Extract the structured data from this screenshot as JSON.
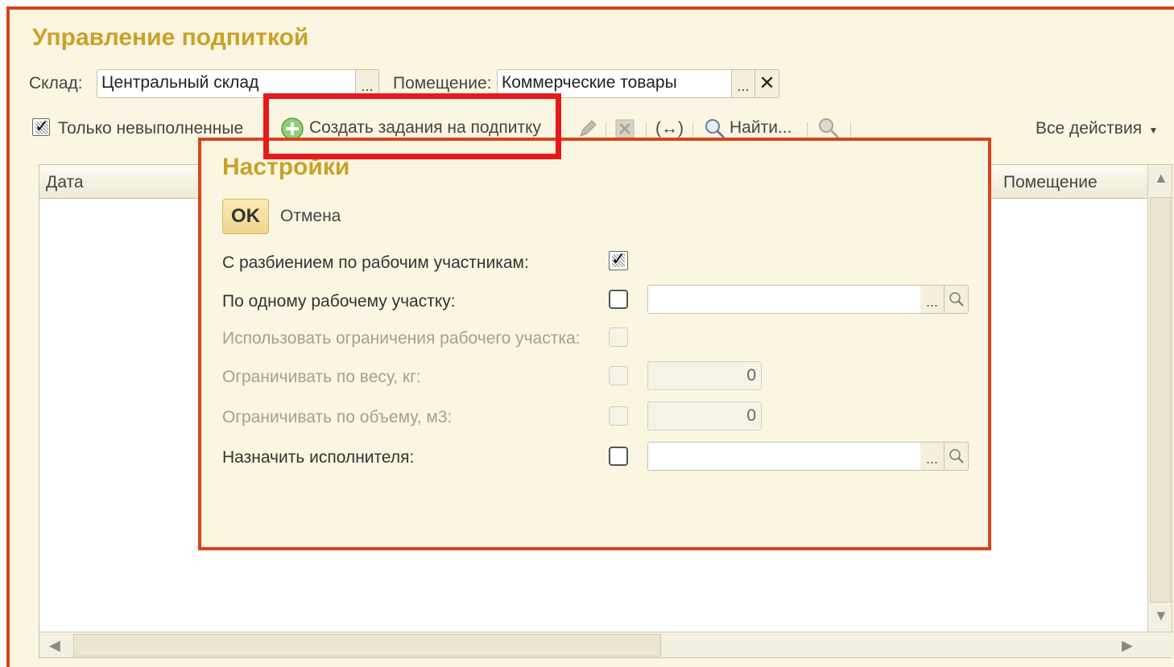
{
  "window": {
    "title": "Управление подпиткой"
  },
  "filters": {
    "warehouse_label": "Склад:",
    "warehouse_value": "Центральный склад",
    "room_label": "Помещение:",
    "room_value": "Коммерческие товары",
    "pick_glyph": "...",
    "clear_glyph": "✕"
  },
  "toolbar": {
    "only_unfinished_label": "Только невыполненные",
    "only_unfinished_checked": true,
    "create_tasks_label": "Создать задания на подпитку",
    "find_label": "Найти...",
    "all_actions_label": "Все действия",
    "swap_glyph": "(↔)"
  },
  "grid": {
    "columns": [
      "Дата",
      "Помещение"
    ]
  },
  "dialog": {
    "title": "Настройки",
    "ok_label": "OK",
    "cancel_label": "Отмена",
    "rows": [
      {
        "label": "С разбиением по рабочим участникам:",
        "checked": true,
        "enabled": true
      },
      {
        "label": "По одному рабочему участку:",
        "checked": false,
        "enabled": true,
        "value": ""
      },
      {
        "label": "Использовать ограничения рабочего участка:",
        "checked": false,
        "enabled": false
      },
      {
        "label": "Ограничивать по весу, кг:",
        "checked": false,
        "enabled": false,
        "value": "0"
      },
      {
        "label": "Ограничивать по объему, м3:",
        "checked": false,
        "enabled": false,
        "value": "0"
      },
      {
        "label": "Назначить исполнителя:",
        "checked": false,
        "enabled": true,
        "value": ""
      }
    ]
  },
  "colors": {
    "title_gold": "#c9a227",
    "frame_orange": "#d9431b",
    "highlight_red": "#e8191b",
    "background": "#fbf6e2"
  }
}
